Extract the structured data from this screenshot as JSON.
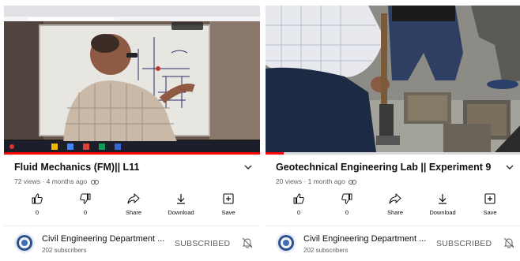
{
  "cards": [
    {
      "title": "Fluid Mechanics (FM)|| L11",
      "meta": "72 views · 4 months ago",
      "progress_fraction": 1.0,
      "actions": {
        "like_count": "0",
        "dislike_count": "0",
        "share_label": "Share",
        "download_label": "Download",
        "save_label": "Save"
      },
      "channel": {
        "name": "Civil Engineering Department ...",
        "subscribers": "202 subscribers",
        "subscribed_label": "SUBSCRIBED"
      }
    },
    {
      "title": "Geotechnical Engineering Lab || Experiment 9",
      "meta": "20 views · 1 month ago",
      "progress_fraction": 0.07,
      "actions": {
        "like_count": "0",
        "dislike_count": "0",
        "share_label": "Share",
        "download_label": "Download",
        "save_label": "Save"
      },
      "channel": {
        "name": "Civil Engineering Department ...",
        "subscribers": "202 subscribers",
        "subscribed_label": "SUBSCRIBED"
      }
    }
  ],
  "colors": {
    "progress": "#ff0000",
    "text_primary": "#0f0f0f",
    "text_secondary": "#606060"
  }
}
